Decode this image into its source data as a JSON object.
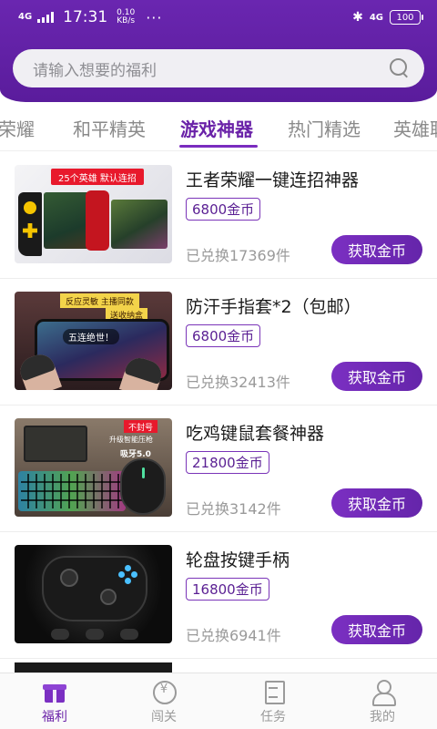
{
  "status_bar": {
    "network": "4G",
    "time": "17:31",
    "speed_value": "0.10",
    "speed_unit": "KB/s",
    "more": "···",
    "network_right": "4G",
    "battery": "100"
  },
  "search": {
    "placeholder": "请输入想要的福利"
  },
  "tabs": [
    {
      "label": "者荣耀",
      "active": false
    },
    {
      "label": "和平精英",
      "active": false
    },
    {
      "label": "游戏神器",
      "active": true
    },
    {
      "label": "热门精选",
      "active": false
    },
    {
      "label": "英雄联盟",
      "active": false
    }
  ],
  "products": [
    {
      "title": "王者荣耀一键连招神器",
      "price": "6800金币",
      "sold": "已兑换17369件",
      "button": "获取金币",
      "image_text": [
        "25个英雄 默认连招"
      ]
    },
    {
      "title": "防汗手指套*2（包邮）",
      "price": "6800金币",
      "sold": "已兑换32413件",
      "button": "获取金币",
      "image_text": [
        "反应灵敏 主播同款",
        "送收纳盒",
        "五连绝世！"
      ]
    },
    {
      "title": "吃鸡键鼠套餐神器",
      "price": "21800金币",
      "sold": "已兑换3142件",
      "button": "获取金币",
      "image_text": [
        "不封号",
        "升级智能压枪",
        "吸牙5.0"
      ]
    },
    {
      "title": "轮盘按键手柄",
      "price": "16800金币",
      "sold": "已兑换6941件",
      "button": "获取金币",
      "image_text": []
    }
  ],
  "bottom_nav": [
    {
      "label": "福利",
      "icon": "gift-icon",
      "active": true
    },
    {
      "label": "闯关",
      "icon": "coin-icon",
      "active": false
    },
    {
      "label": "任务",
      "icon": "task-icon",
      "active": false
    },
    {
      "label": "我的",
      "icon": "user-icon",
      "active": false
    }
  ],
  "colors": {
    "brand": "#6a22a8",
    "header": "#6a26b0",
    "button": "#7b2fc2"
  }
}
